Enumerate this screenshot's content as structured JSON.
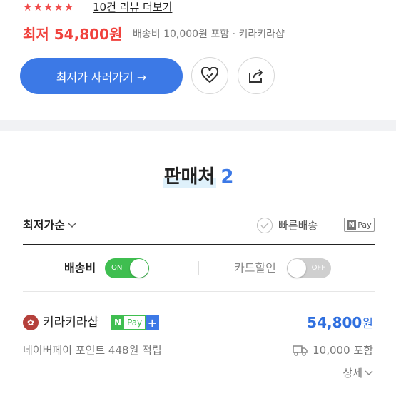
{
  "rating": {
    "stars": 5,
    "review_link": "10건 리뷰 더보기"
  },
  "price": {
    "lowest_label": "최저 54,800원",
    "meta": "배송비 10,000원 포함 · 키라키라샵"
  },
  "actions": {
    "cta_label": "최저가 사러가기 →",
    "heart_icon": "heart-outline-icon",
    "share_icon": "share-icon"
  },
  "sellers_section": {
    "title": "판매처",
    "count": "2"
  },
  "filters": {
    "sort_label": "최저가순",
    "fast_shipping_label": "빠른배송",
    "npay_filter": {
      "n": "N",
      "text": "Pay"
    },
    "shipping_toggle_label": "배송비",
    "shipping_toggle_state": "ON",
    "card_discount_label": "카드할인",
    "card_discount_state": "OFF"
  },
  "seller": {
    "name": "키라키라샵",
    "npay_badge": {
      "n": "N",
      "text": "Pay"
    },
    "plus_badge": "+",
    "price": "54,800",
    "price_unit": "원",
    "points": "네이버페이 포인트 448원 적립",
    "shipping_fee": "10,000 포함",
    "detail_link": "상세"
  },
  "colors": {
    "accent_blue": "#3c79e6",
    "price_red": "#f0413c",
    "toggle_green": "#3fbe50"
  }
}
